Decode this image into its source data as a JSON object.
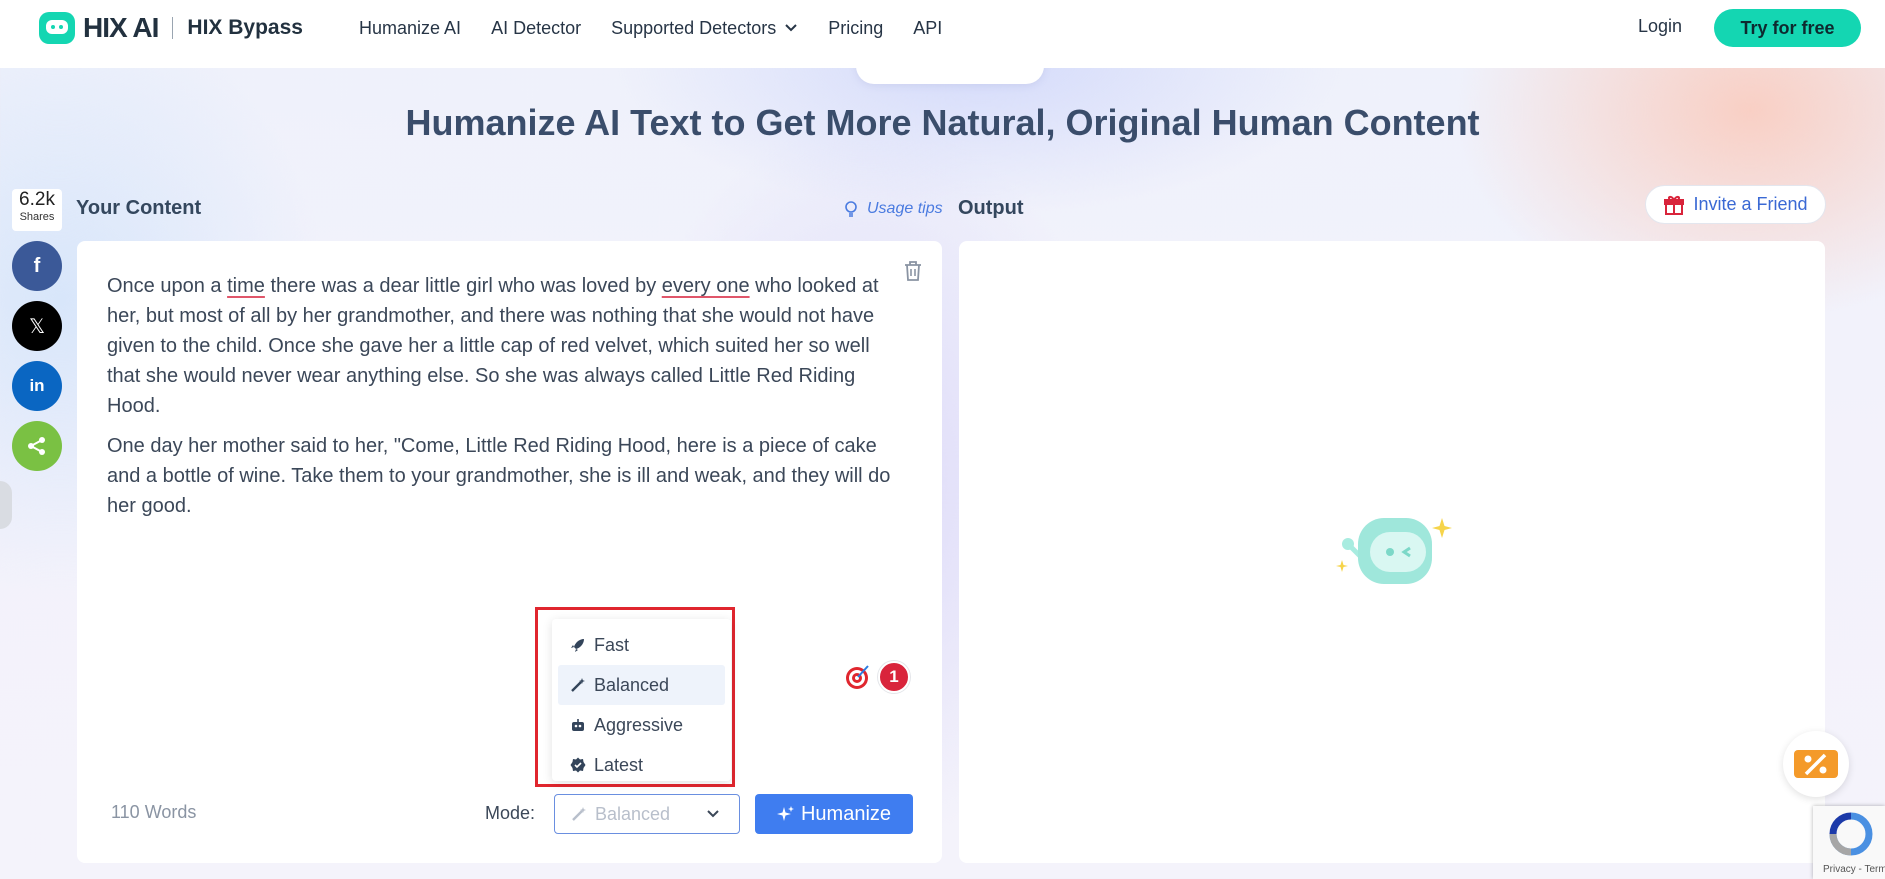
{
  "nav": {
    "logo_text": "HIX AI",
    "product": "HIX Bypass",
    "menu": [
      "Humanize AI",
      "AI Detector",
      "Supported Detectors",
      "Pricing",
      "API"
    ],
    "login": "Login",
    "try_free": "Try for free"
  },
  "hero": {
    "title": "Humanize AI Text to Get More Natural, Original Human Content"
  },
  "share": {
    "count": "6.2k",
    "label": "Shares",
    "colors": {
      "facebook": "#3b5998",
      "x": "#000000",
      "linkedin": "#0a66c2",
      "share": "#7ac143"
    }
  },
  "input_panel": {
    "title": "Your Content",
    "usage_tips": "Usage tips",
    "paragraph1_a": "Once upon a ",
    "paragraph1_u1": "time",
    "paragraph1_b": " there was a dear little girl who was loved by ",
    "paragraph1_u2": "every one",
    "paragraph1_c": " who looked at her, but most of all by her grandmother, and there was nothing that she would not have given to the child. Once she gave her a little cap of red velvet, which suited her so well that she would never wear anything else. So she was always called Little Red Riding Hood.",
    "paragraph2": "One day her mother said to her, \"Come, Little Red Riding Hood, here is a piece of cake and a bottle of wine. Take them to your grandmother, she is ill and weak, and they will do her good.",
    "word_count": "110 Words",
    "mode_label": "Mode:",
    "mode_selected": "Balanced",
    "humanize_button": "Humanize",
    "notification_count": "1"
  },
  "mode_options": [
    {
      "label": "Fast",
      "icon": "rocket-icon"
    },
    {
      "label": "Balanced",
      "icon": "magic-wand-icon"
    },
    {
      "label": "Aggressive",
      "icon": "robot-icon"
    },
    {
      "label": "Latest",
      "icon": "badge-icon"
    }
  ],
  "output_panel": {
    "title": "Output",
    "invite": "Invite a Friend"
  },
  "recaptcha": {
    "text": "Privacy - Terms"
  },
  "colors": {
    "accent": "#14d6b2",
    "primary": "#3f7df0",
    "highlight_border": "#e0262e"
  }
}
